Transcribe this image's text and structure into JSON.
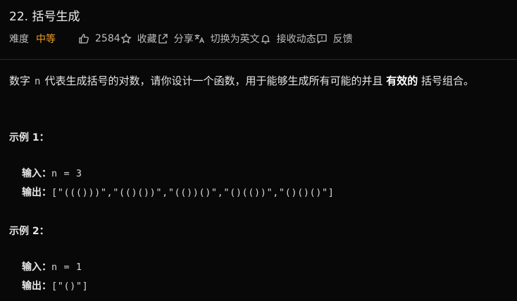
{
  "problem": {
    "title": "22. 括号生成"
  },
  "meta": {
    "difficulty_label": "难度",
    "difficulty_value": "中等",
    "likes": "2584",
    "collect_label": "收藏",
    "share_label": "分享",
    "switch_label": "切换为英文",
    "subscribe_label": "接收动态",
    "feedback_label": "反馈",
    "difficulty_color": "#f0a020"
  },
  "description": {
    "part1": "数字",
    "code": "n",
    "part2": "代表生成括号的对数，请你设计一个函数，用于能够生成所有可能的并且",
    "bold": "有效的",
    "part3": "括号组合。"
  },
  "examples": [
    {
      "title": "示例 1：",
      "input_label": "输入：",
      "input_value": "n = 3",
      "output_label": "输出：",
      "output_value": "[\"((()))\",\"(()())\",\"(())()\",\"()(())\",\"()()()\"]"
    },
    {
      "title": "示例 2：",
      "input_label": "输入：",
      "input_value": "n = 1",
      "output_label": "输出：",
      "output_value": "[\"()\"]"
    }
  ],
  "icons": {
    "like": "thumbs-up-icon",
    "collect": "star-icon",
    "share": "share-icon",
    "switch": "translate-icon",
    "subscribe": "bell-icon",
    "feedback": "feedback-icon"
  }
}
